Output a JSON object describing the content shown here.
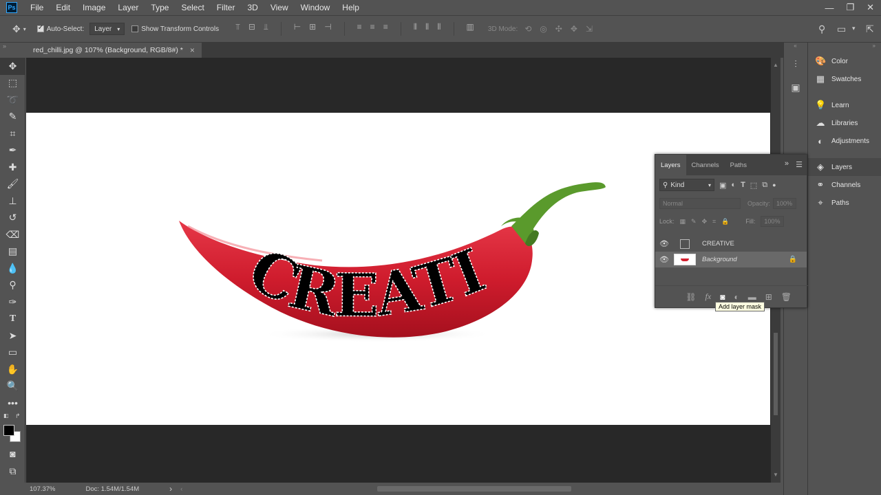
{
  "app": {
    "logo": "Ps"
  },
  "menu": [
    "File",
    "Edit",
    "Image",
    "Layer",
    "Type",
    "Select",
    "Filter",
    "3D",
    "View",
    "Window",
    "Help"
  ],
  "window_controls": {
    "minimize": "—",
    "restore": "❐",
    "close": "✕"
  },
  "options": {
    "auto_select_label": "Auto-Select:",
    "auto_select_checked": true,
    "target_value": "Layer",
    "show_transform_label": "Show Transform Controls",
    "mode_3d_label": "3D Mode:"
  },
  "document": {
    "tab_title": "red_chilli.jpg @ 107% (Background, RGB/8#) *",
    "close_glyph": "×",
    "artwork_text": "CREATIVE"
  },
  "status": {
    "zoom": "107.37%",
    "doc_size": "Doc: 1.54M/1.54M",
    "arrow": "›"
  },
  "panel_column": [
    {
      "label": "Color",
      "icon": "color-palette-icon"
    },
    {
      "label": "Swatches",
      "icon": "grid-icon"
    },
    {
      "label": "Learn",
      "icon": "lightbulb-icon"
    },
    {
      "label": "Libraries",
      "icon": "cloud-icon"
    },
    {
      "label": "Adjustments",
      "icon": "half-circle-icon"
    },
    {
      "label": "Layers",
      "icon": "layers-icon",
      "active": true
    },
    {
      "label": "Channels",
      "icon": "channels-icon"
    },
    {
      "label": "Paths",
      "icon": "pen-path-icon"
    }
  ],
  "layers_panel": {
    "tabs": [
      "Layers",
      "Channels",
      "Paths"
    ],
    "active_tab": "Layers",
    "kind_label": "Kind",
    "blend_mode": "Normal",
    "opacity_label": "Opacity:",
    "opacity_value": "100%",
    "lock_label": "Lock:",
    "fill_label": "Fill:",
    "fill_value": "100%",
    "layers": [
      {
        "name": "CREATIVE",
        "type": "text-mask",
        "visible": true,
        "selected": false,
        "locked": false
      },
      {
        "name": "Background",
        "type": "image",
        "visible": true,
        "selected": true,
        "locked": true
      }
    ],
    "tooltip": "Add layer mask"
  },
  "colors": {
    "ui_bg": "#535353",
    "canvas_bg": "#282828",
    "chilli_red": "#d5202f",
    "stem_green": "#5a9a2c",
    "accent": "#31a8ff"
  }
}
